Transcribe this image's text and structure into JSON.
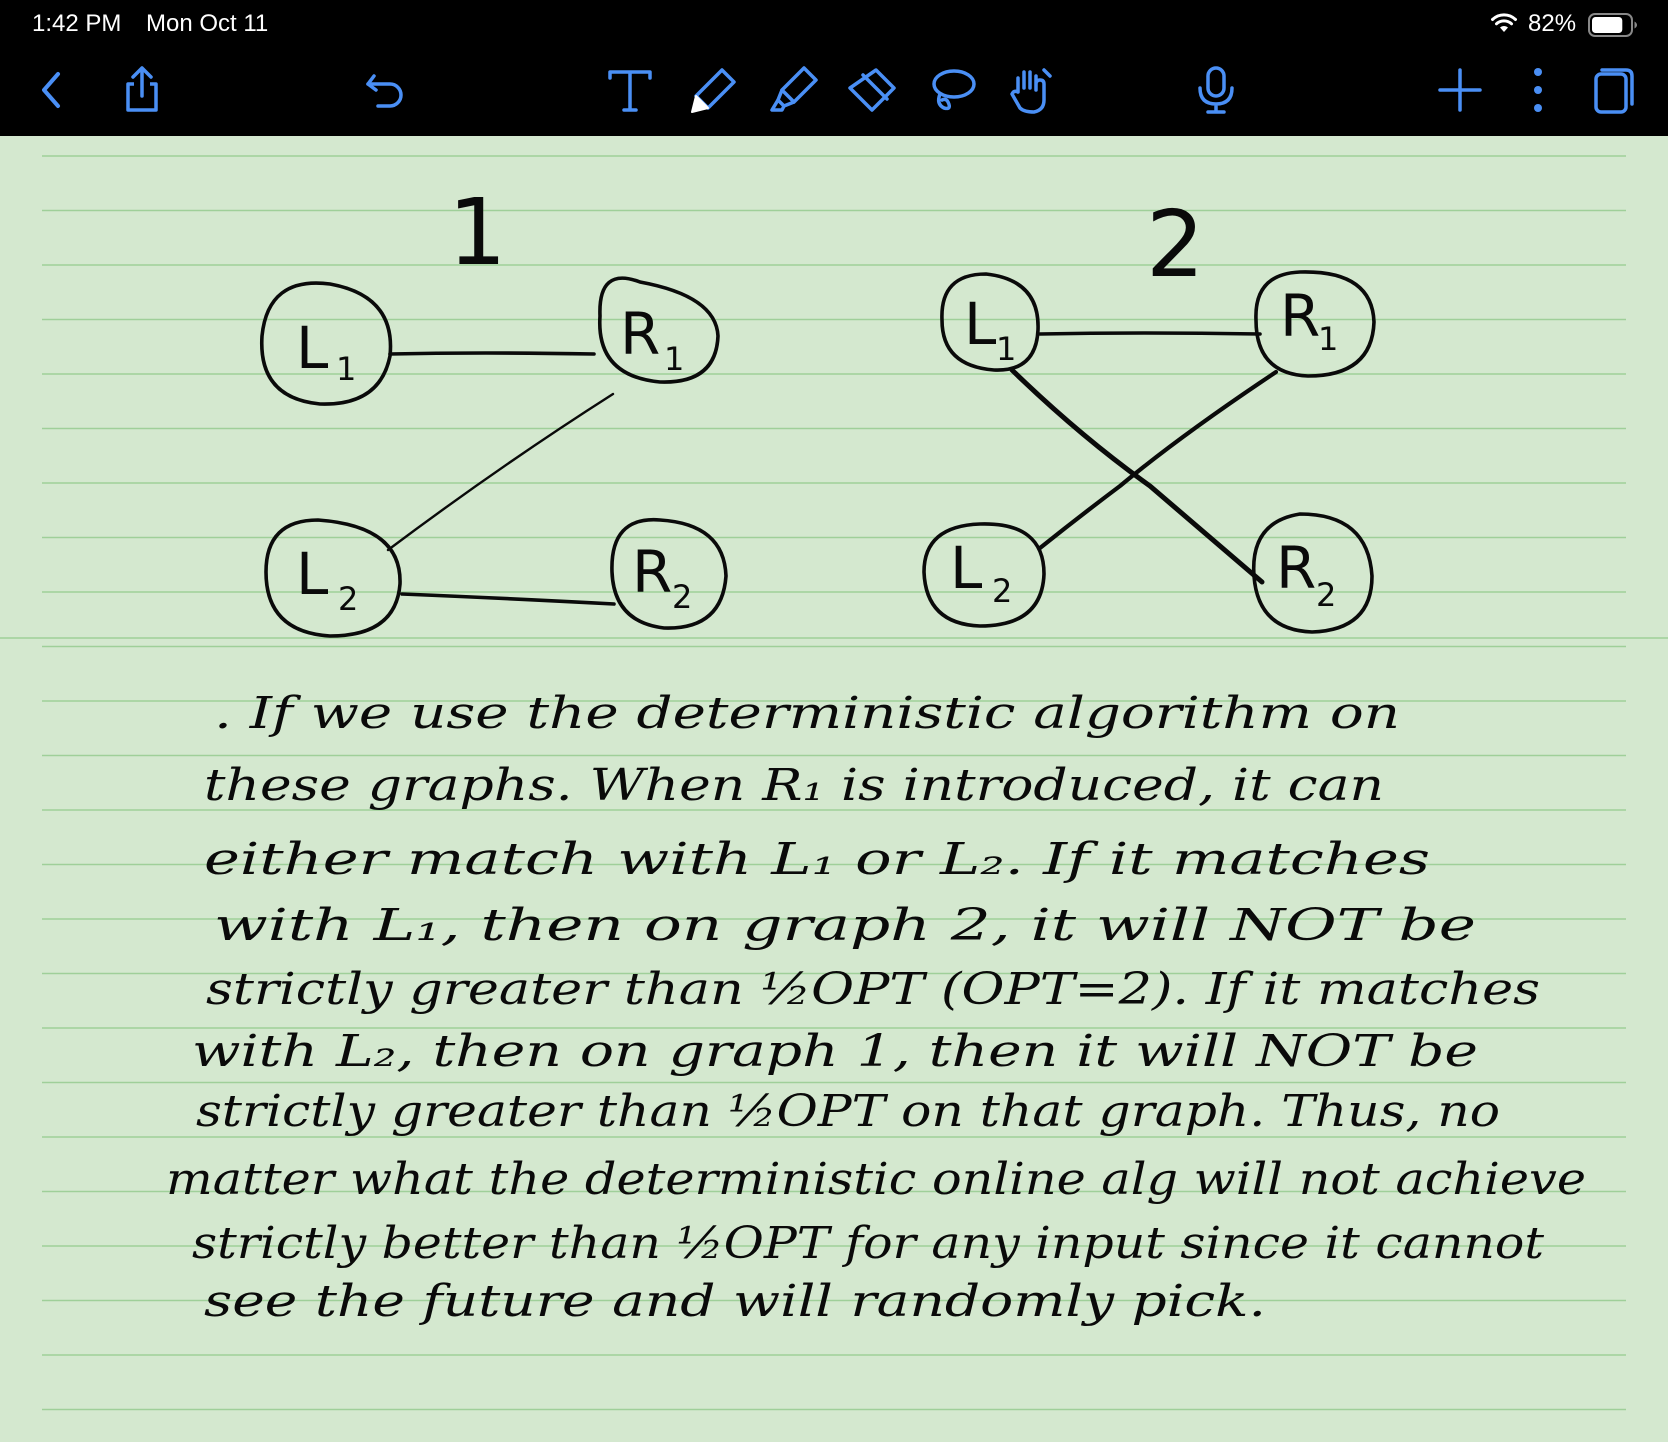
{
  "status_bar": {
    "time": "1:42 PM",
    "date": "Mon Oct 11",
    "battery_percent": "82%",
    "battery_level": 0.82
  },
  "toolbar": {
    "accent_color": "#4a8ff5",
    "left_icons": [
      "chevron-left-icon",
      "share-icon",
      "undo-icon"
    ],
    "center_icons": [
      "text-tool-icon",
      "pen-tool-icon",
      "highlighter-tool-icon",
      "eraser-tool-icon",
      "lasso-tool-icon",
      "hand-tool-icon",
      "microphone-icon"
    ],
    "right_icons": [
      "plus-icon",
      "more-vertical-icon",
      "pages-icon"
    ]
  },
  "paper": {
    "background_color": "#d4e8cf",
    "rule_color": "#9fcf99"
  },
  "graphs": [
    {
      "title": "1",
      "nodes": [
        {
          "label": "L",
          "sub": "1"
        },
        {
          "label": "R",
          "sub": "1"
        },
        {
          "label": "L",
          "sub": "2"
        },
        {
          "label": "R",
          "sub": "2"
        }
      ],
      "edges": [
        [
          "L1",
          "R1"
        ],
        [
          "R1",
          "L2"
        ],
        [
          "L2",
          "R2"
        ]
      ]
    },
    {
      "title": "2",
      "nodes": [
        {
          "label": "L",
          "sub": "1"
        },
        {
          "label": "R",
          "sub": "1"
        },
        {
          "label": "L",
          "sub": "2"
        },
        {
          "label": "R",
          "sub": "2"
        }
      ],
      "edges": [
        [
          "L1",
          "R1"
        ],
        [
          "L1",
          "R2"
        ],
        [
          "R1",
          "L2"
        ]
      ]
    }
  ],
  "notes": [
    ". If we use the deterministic algorithm on",
    "these graphs. When R₁ is introduced, it can",
    "either match with L₁ or L₂. If it matches",
    "with L₁, then on graph 2, it will NOT be",
    "strictly greater than ½OPT (OPT=2). If it matches",
    "with L₂, then on graph 1, then it will NOT be",
    "strictly greater than ½OPT on that graph. Thus, no",
    "matter what the deterministic online alg will not achieve",
    "strictly better than ½OPT for any input since it cannot",
    "see the future and will randomly pick."
  ]
}
